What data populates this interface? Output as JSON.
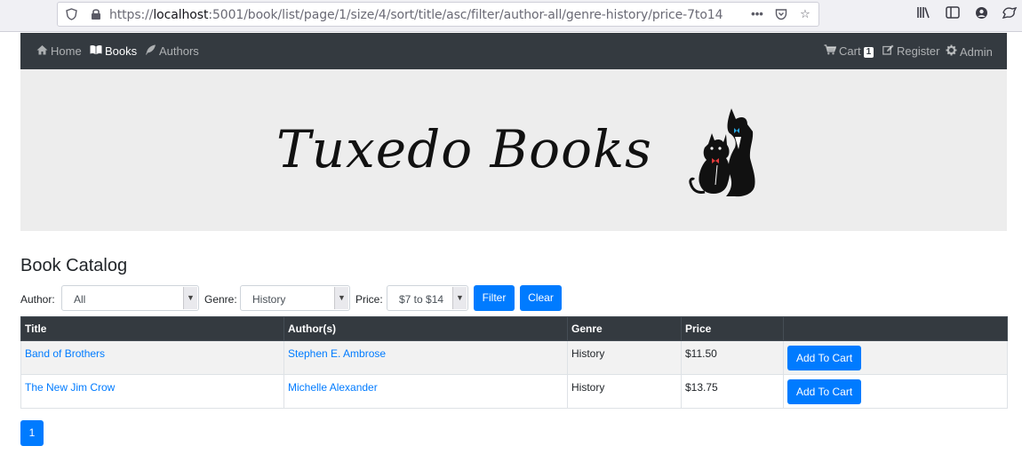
{
  "browser": {
    "url_prefix": "https://",
    "url_host": "localhost",
    "url_path": ":5001/book/list/page/1/size/4/sort/title/asc/filter/author-all/genre-history/price-7to14",
    "icons": [
      "shield-icon",
      "lock-icon",
      "more-icon",
      "pocket-icon",
      "bookmark-star-icon",
      "library-icon",
      "sidebar-icon",
      "account-icon",
      "extension-icon"
    ]
  },
  "navbar": {
    "home": "Home",
    "books": "Books",
    "authors": "Authors",
    "cart": "Cart",
    "cart_count": "1",
    "register": "Register",
    "admin": "Admin"
  },
  "banner": {
    "logo_text": "Tuxedo Books"
  },
  "catalog": {
    "heading": "Book Catalog",
    "filters": {
      "author_label": "Author:",
      "author_value": "All",
      "genre_label": "Genre:",
      "genre_value": "History",
      "price_label": "Price:",
      "price_value": "$7 to $14",
      "filter_button": "Filter",
      "clear_button": "Clear"
    },
    "columns": [
      "Title",
      "Author(s)",
      "Genre",
      "Price",
      ""
    ],
    "rows": [
      {
        "title": "Band of Brothers",
        "author": "Stephen E. Ambrose",
        "genre": "History",
        "price": "$11.50",
        "action": "Add To Cart"
      },
      {
        "title": "The New Jim Crow",
        "author": "Michelle Alexander",
        "genre": "History",
        "price": "$13.75",
        "action": "Add To Cart"
      }
    ],
    "pagination": [
      "1"
    ]
  },
  "colors": {
    "navbar_bg": "#343a40",
    "primary": "#007bff",
    "banner_bg": "#ededed"
  }
}
